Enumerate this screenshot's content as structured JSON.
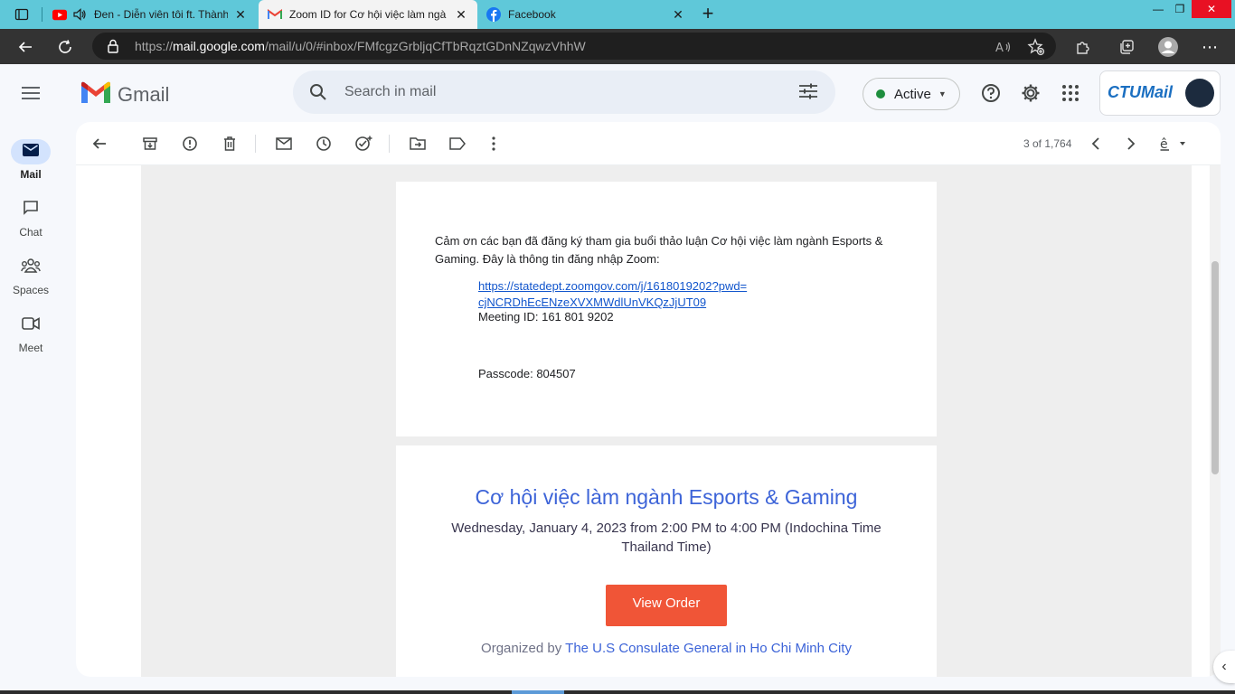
{
  "browser": {
    "tabs": [
      {
        "title": "Đen - Diễn viên tôi ft. Thành",
        "icon": "youtube-icon"
      },
      {
        "title": "Zoom ID for Cơ hội việc làm ngà",
        "icon": "gmail-icon"
      },
      {
        "title": "Facebook",
        "icon": "facebook-icon"
      }
    ],
    "url_prefix": "https://",
    "url_host": "mail.google.com",
    "url_path": "/mail/u/0/#inbox/FMfcgzGrbljqCfTbRqztGDnNZqwzVhhW"
  },
  "gmail": {
    "app_name": "Gmail",
    "search_placeholder": "Search in mail",
    "status": "Active",
    "status_color": "#1e8e3e",
    "account_logo": "CTUMail"
  },
  "nav": {
    "items": [
      {
        "label": "Mail",
        "icon": "mail-icon",
        "active": true
      },
      {
        "label": "Chat",
        "icon": "chat-icon",
        "active": false
      },
      {
        "label": "Spaces",
        "icon": "spaces-icon",
        "active": false
      },
      {
        "label": "Meet",
        "icon": "meet-icon",
        "active": false
      }
    ]
  },
  "toolbar": {
    "pager": "3 of 1,764"
  },
  "email": {
    "intro": "Cảm ơn các bạn đã đăng ký tham gia buổi thảo luận Cơ hội việc làm ngành Esports & Gaming. Đây là thông tin đăng nhập Zoom:",
    "link_line1": "https://statedept.zoomgov.com/j/1618019202?pwd=",
    "link_line2": "cjNCRDhEcENzeXVXMWdlUnVKQzJjUT09",
    "meeting_id": "Meeting ID: 161 801 9202",
    "passcode": "Passcode: 804507"
  },
  "event": {
    "title": "Cơ hội việc làm ngành Esports & Gaming",
    "date_line1": "Wednesday, January 4, 2023 from 2:00 PM to 4:00 PM (Indochina Time",
    "date_line2": "Thailand Time)",
    "button_label": "View Order",
    "button_color": "#f05537",
    "organized_by": "Organized by",
    "organizer": "The U.S Consulate General in Ho Chi Minh City"
  }
}
